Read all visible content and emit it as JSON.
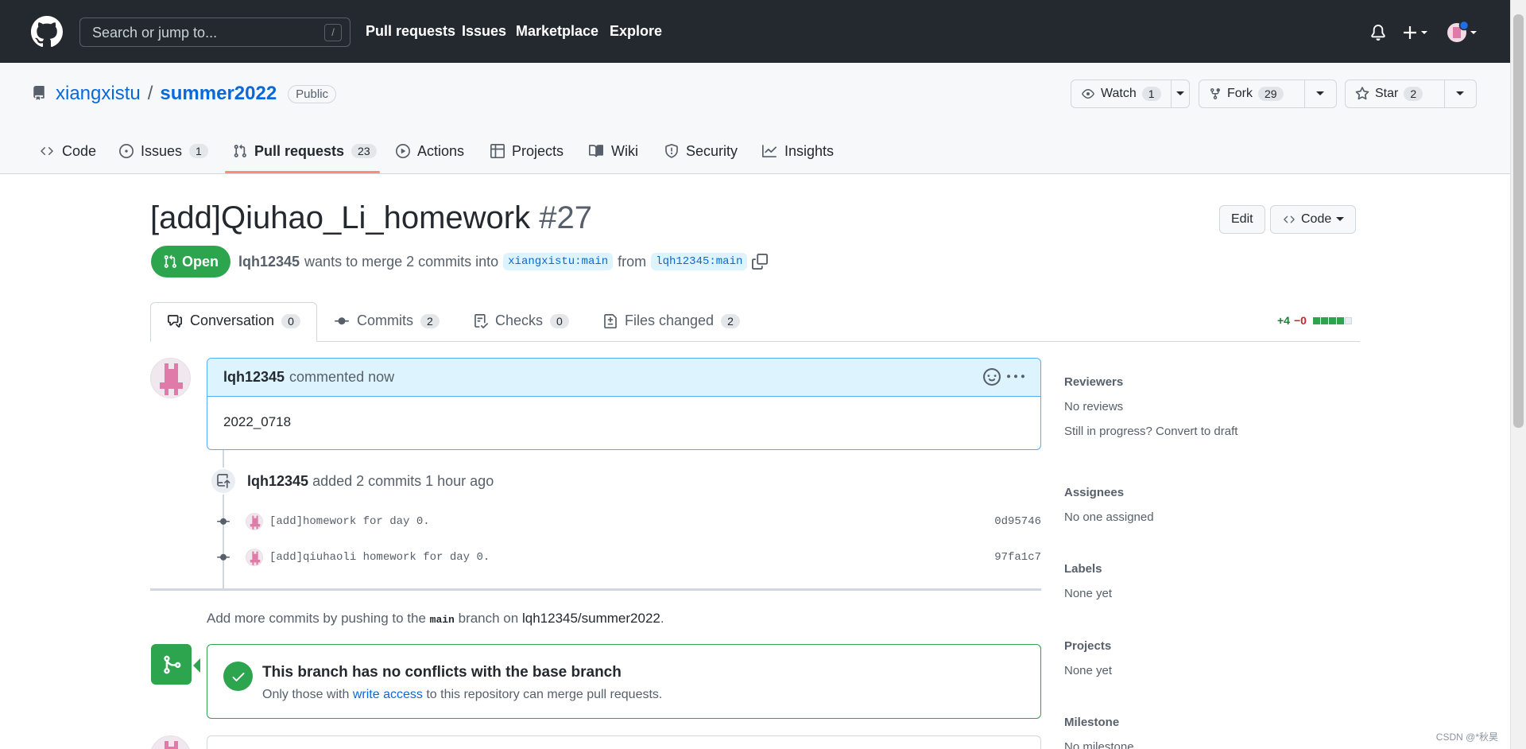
{
  "header": {
    "search_placeholder": "Search or jump to...",
    "search_shortcut": "/",
    "nav": [
      "Pull requests",
      "Issues",
      "Marketplace",
      "Explore"
    ]
  },
  "repo": {
    "owner": "xiangxistu",
    "separator": "/",
    "name": "summer2022",
    "visibility": "Public",
    "watch_label": "Watch",
    "watch_count": "1",
    "fork_label": "Fork",
    "fork_count": "29",
    "star_label": "Star",
    "star_count": "2"
  },
  "tabs": {
    "code": "Code",
    "issues": "Issues",
    "issues_count": "1",
    "pulls": "Pull requests",
    "pulls_count": "23",
    "actions": "Actions",
    "projects": "Projects",
    "wiki": "Wiki",
    "security": "Security",
    "insights": "Insights"
  },
  "pr": {
    "title": "[add]Qiuhao_Li_homework",
    "number": "#27",
    "edit_label": "Edit",
    "code_label": "Code",
    "state": "Open",
    "author": "lqh12345",
    "merge_text": "wants to merge 2 commits into",
    "base_branch": "xiangxistu:main",
    "from_text": "from",
    "head_branch": "lqh12345:main"
  },
  "prtabs": {
    "conversation": "Conversation",
    "conversation_count": "0",
    "commits": "Commits",
    "commits_count": "2",
    "checks": "Checks",
    "checks_count": "0",
    "files": "Files changed",
    "files_count": "2",
    "additions": "+4",
    "deletions": "−0"
  },
  "comment": {
    "author": "lqh12345",
    "when": "commented now",
    "body": "2022_0718"
  },
  "timeline": {
    "author": "lqh12345",
    "text": "added 2 commits 1 hour ago",
    "commits": [
      {
        "message": "[add]homework for day 0.",
        "sha": "0d95746"
      },
      {
        "message": "[add]qiuhaoli homework for day 0.",
        "sha": "97fa1c7"
      }
    ]
  },
  "hint": {
    "pre": "Add more commits by pushing to the",
    "branch": "main",
    "mid": "branch on",
    "repo": "lqh12345/summer2022",
    "end": "."
  },
  "merge": {
    "title": "This branch has no conflicts with the base branch",
    "sub_pre": "Only those with",
    "sub_link": "write access",
    "sub_post": "to this repository can merge pull requests."
  },
  "sidebar": {
    "reviewers_title": "Reviewers",
    "reviewers_value": "No reviews",
    "draft_hint": "Still in progress? Convert to draft",
    "assignees_title": "Assignees",
    "assignees_value": "No one assigned",
    "labels_title": "Labels",
    "labels_value": "None yet",
    "projects_title": "Projects",
    "projects_value": "None yet",
    "milestone_title": "Milestone",
    "milestone_value": "No milestone"
  },
  "watermark": "CSDN @*秋昊",
  "colors": {
    "header_bg": "#24292f",
    "accent_blue": "#0969da",
    "open_green": "#2da44e",
    "tab_underline": "#fd8c73",
    "comment_bg": "#ddf4ff"
  }
}
